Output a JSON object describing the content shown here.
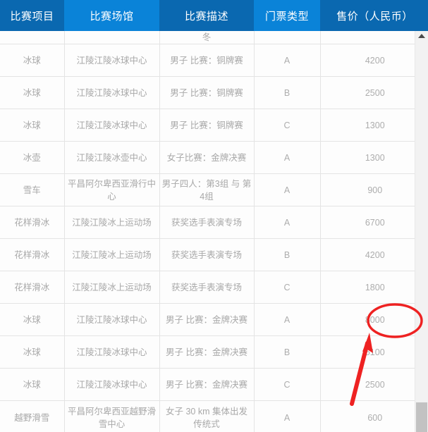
{
  "table": {
    "columns": [
      {
        "label": "比赛项目",
        "style": "dark"
      },
      {
        "label": "比赛场馆",
        "style": "light"
      },
      {
        "label": "比赛描述",
        "style": "dark"
      },
      {
        "label": "门票类型",
        "style": "light"
      },
      {
        "label": "售价（人民币）",
        "style": "dark"
      }
    ],
    "partial_row": {
      "event": "",
      "venue": "",
      "description": "冬",
      "ticket_type": "",
      "price": ""
    },
    "rows": [
      {
        "event": "冰球",
        "venue": "江陵江陵冰球中心",
        "description": "男子 比赛：铜牌赛",
        "ticket_type": "A",
        "price": "4200"
      },
      {
        "event": "冰球",
        "venue": "江陵江陵冰球中心",
        "description": "男子 比赛：铜牌赛",
        "ticket_type": "B",
        "price": "2500"
      },
      {
        "event": "冰球",
        "venue": "江陵江陵冰球中心",
        "description": "男子 比赛：铜牌赛",
        "ticket_type": "C",
        "price": "1300"
      },
      {
        "event": "冰壶",
        "venue": "江陵江陵冰壶中心",
        "description": "女子比赛：金牌决赛",
        "ticket_type": "A",
        "price": "1300"
      },
      {
        "event": "雪车",
        "venue": "平昌阿尔卑西亚滑行中心",
        "description": "男子四人：第3组 与 第4组",
        "ticket_type": "A",
        "price": "900"
      },
      {
        "event": "花样滑冰",
        "venue": "江陵江陵冰上运动场",
        "description": "获奖选手表演专场",
        "ticket_type": "A",
        "price": "6700"
      },
      {
        "event": "花样滑冰",
        "venue": "江陵江陵冰上运动场",
        "description": "获奖选手表演专场",
        "ticket_type": "B",
        "price": "4200"
      },
      {
        "event": "花样滑冰",
        "venue": "江陵江陵冰上运动场",
        "description": "获奖选手表演专场",
        "ticket_type": "C",
        "price": "1800"
      },
      {
        "event": "冰球",
        "venue": "江陵江陵冰球中心",
        "description": "男子 比赛：金牌决赛",
        "ticket_type": "A",
        "price": "8000",
        "highlighted": true
      },
      {
        "event": "冰球",
        "venue": "江陵江陵冰球中心",
        "description": "男子 比赛：金牌决赛",
        "ticket_type": "B",
        "price": "5100"
      },
      {
        "event": "冰球",
        "venue": "江陵江陵冰球中心",
        "description": "男子 比赛：金牌决赛",
        "ticket_type": "C",
        "price": "2500"
      },
      {
        "event": "越野滑雪",
        "venue": "平昌阿尔卑西亚越野滑雪中心",
        "description": "女子 30 km 集体出发 传统式",
        "ticket_type": "A",
        "price": "600",
        "tall": true
      }
    ]
  },
  "annotations": {
    "ellipse": {
      "target_value": "8000",
      "color": "#ee2222"
    },
    "arrow": {
      "color": "#ee2222"
    }
  },
  "scrollbar": {
    "up_arrow_icon": "scroll-up-arrow-icon",
    "thumb_color": "#c2c2c2"
  },
  "colors": {
    "header_dark": "#0a68b0",
    "header_light": "#0a83d8",
    "grid": "#e4e4e4",
    "text": "#a8a8a8",
    "annotation_red": "#ee2222"
  }
}
